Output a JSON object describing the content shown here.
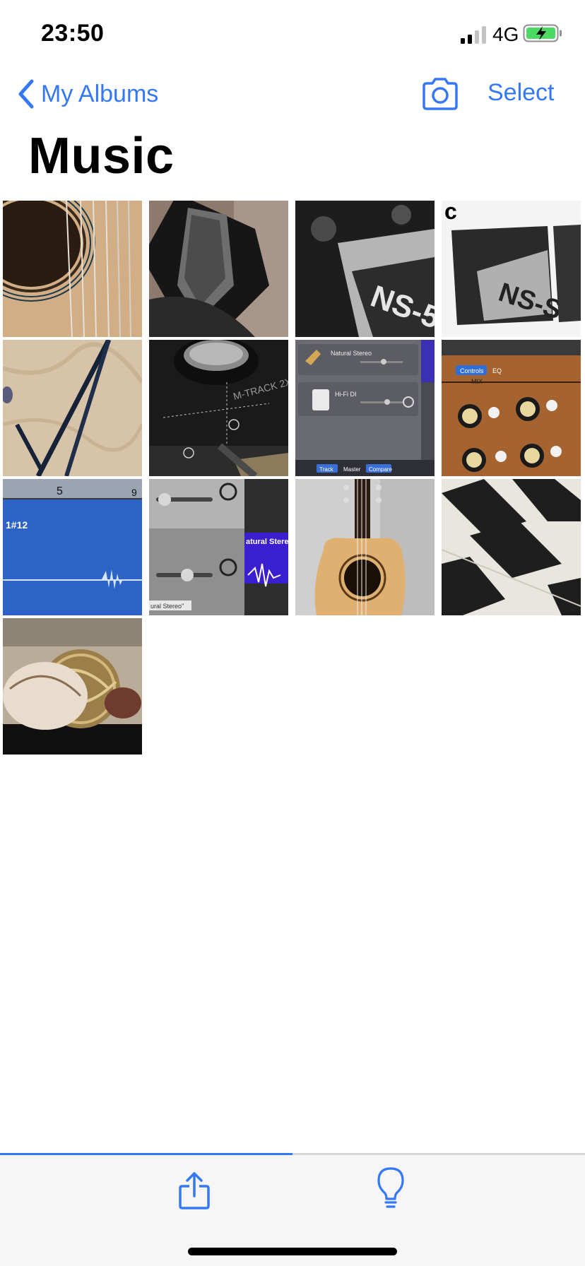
{
  "status_bar": {
    "time": "23:50",
    "network": "4G",
    "signal_icon": "cellular-signal-icon",
    "battery_icon": "battery-charging-icon"
  },
  "nav": {
    "back_label": "My Albums",
    "back_icon": "chevron-left-icon",
    "camera_icon": "camera-icon",
    "select_label": "Select"
  },
  "title": "Music",
  "photos": [
    {
      "subject": "acoustic-guitar-soundhole"
    },
    {
      "subject": "microphone-grille"
    },
    {
      "subject": "boss-pedal"
    },
    {
      "subject": "boss-pedal-collage"
    },
    {
      "subject": "cables-on-wood"
    },
    {
      "subject": "m-track-audio-interface"
    },
    {
      "subject": "garageband-track-settings"
    },
    {
      "subject": "drum-mix-controls"
    },
    {
      "subject": "waveform-timeline"
    },
    {
      "subject": "mixer-faders-waveform"
    },
    {
      "subject": "acoustic-guitar"
    },
    {
      "subject": "piano-keys"
    },
    {
      "subject": "decorative-balls"
    }
  ],
  "toolbar": {
    "share_icon": "share-icon",
    "bulb_icon": "lightbulb-icon",
    "progress": 0.5
  },
  "colors": {
    "accent": "#3478f6",
    "toolbar_bg": "#f6f6f6"
  }
}
